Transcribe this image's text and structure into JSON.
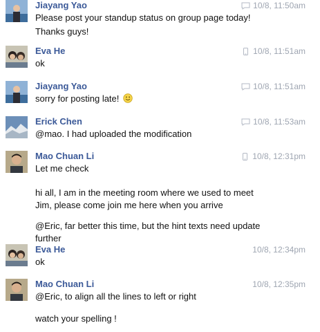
{
  "messages": [
    {
      "sender": "Jiayang Yao",
      "time": "10/8, 11:50am",
      "source_icon": "chat-bubble-icon",
      "lines": [
        "Please post your standup status on group page today!",
        "Thanks guys!"
      ]
    },
    {
      "sender": "Eva He",
      "time": "10/8, 11:51am",
      "source_icon": "mobile-phone-icon",
      "lines": [
        "ok"
      ]
    },
    {
      "sender": "Jiayang Yao",
      "time": "10/8, 11:51am",
      "source_icon": "chat-bubble-icon",
      "lines": [
        "sorry for posting late!"
      ],
      "emoji": "smiley-emoji-icon"
    },
    {
      "sender": "Erick Chen",
      "time": "10/8, 11:53am",
      "source_icon": "chat-bubble-icon",
      "lines": [
        "@mao. I had uploaded the modification"
      ]
    },
    {
      "sender": "Mao Chuan Li",
      "time": "10/8, 12:31pm",
      "source_icon": "mobile-phone-icon",
      "lines": [
        "Let me check"
      ],
      "extra_paragraphs": [
        [
          "hi all, I am in the meeting room where we used to meet",
          "Jim, please come join me here when you arrive"
        ],
        [
          "@Eric, far better this time, but the hint texts need update",
          "further"
        ]
      ]
    },
    {
      "sender": "Eva He",
      "time": "10/8, 12:34pm",
      "source_icon": "",
      "lines": [
        "ok"
      ]
    },
    {
      "sender": "Mao Chuan Li",
      "time": "10/8, 12:35pm",
      "source_icon": "",
      "lines": [
        "@Eric, to align all the lines to left or right"
      ],
      "extra_paragraphs": [
        [
          "watch your spelling !"
        ]
      ]
    }
  ],
  "colors": {
    "sender": "#3b5998",
    "time": "#9ea5b1",
    "body_text": "#111111",
    "background": "#ffffff"
  }
}
